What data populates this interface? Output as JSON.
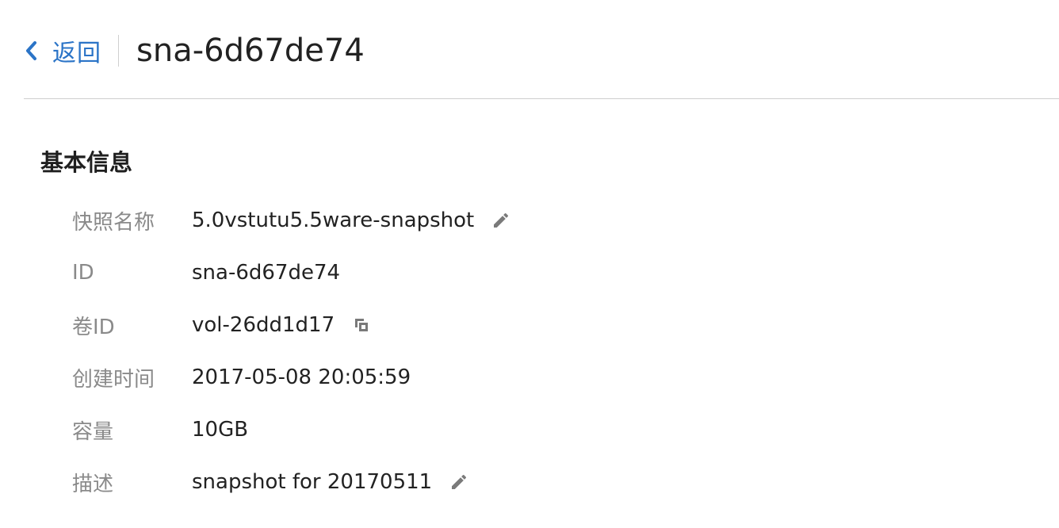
{
  "header": {
    "back_label": "返回",
    "title": "sna-6d67de74"
  },
  "section": {
    "title": "基本信息"
  },
  "fields": [
    {
      "label": "快照名称",
      "value": "5.0vstutu5.5ware-snapshot",
      "action_icon": "edit-icon"
    },
    {
      "label": "ID",
      "value": "sna-6d67de74",
      "action_icon": ""
    },
    {
      "label": "卷ID",
      "value": "vol-26dd1d17",
      "action_icon": "copy-icon"
    },
    {
      "label": "创建时间",
      "value": "2017-05-08 20:05:59",
      "action_icon": ""
    },
    {
      "label": "容量",
      "value": "10GB",
      "action_icon": ""
    },
    {
      "label": "描述",
      "value": "snapshot for 20170511",
      "action_icon": "edit-icon"
    }
  ],
  "colors": {
    "accent": "#2b74c7",
    "label": "#8a8a8a",
    "text": "#222222",
    "icon": "#7a7a7a",
    "divider": "#cfcfcf"
  }
}
